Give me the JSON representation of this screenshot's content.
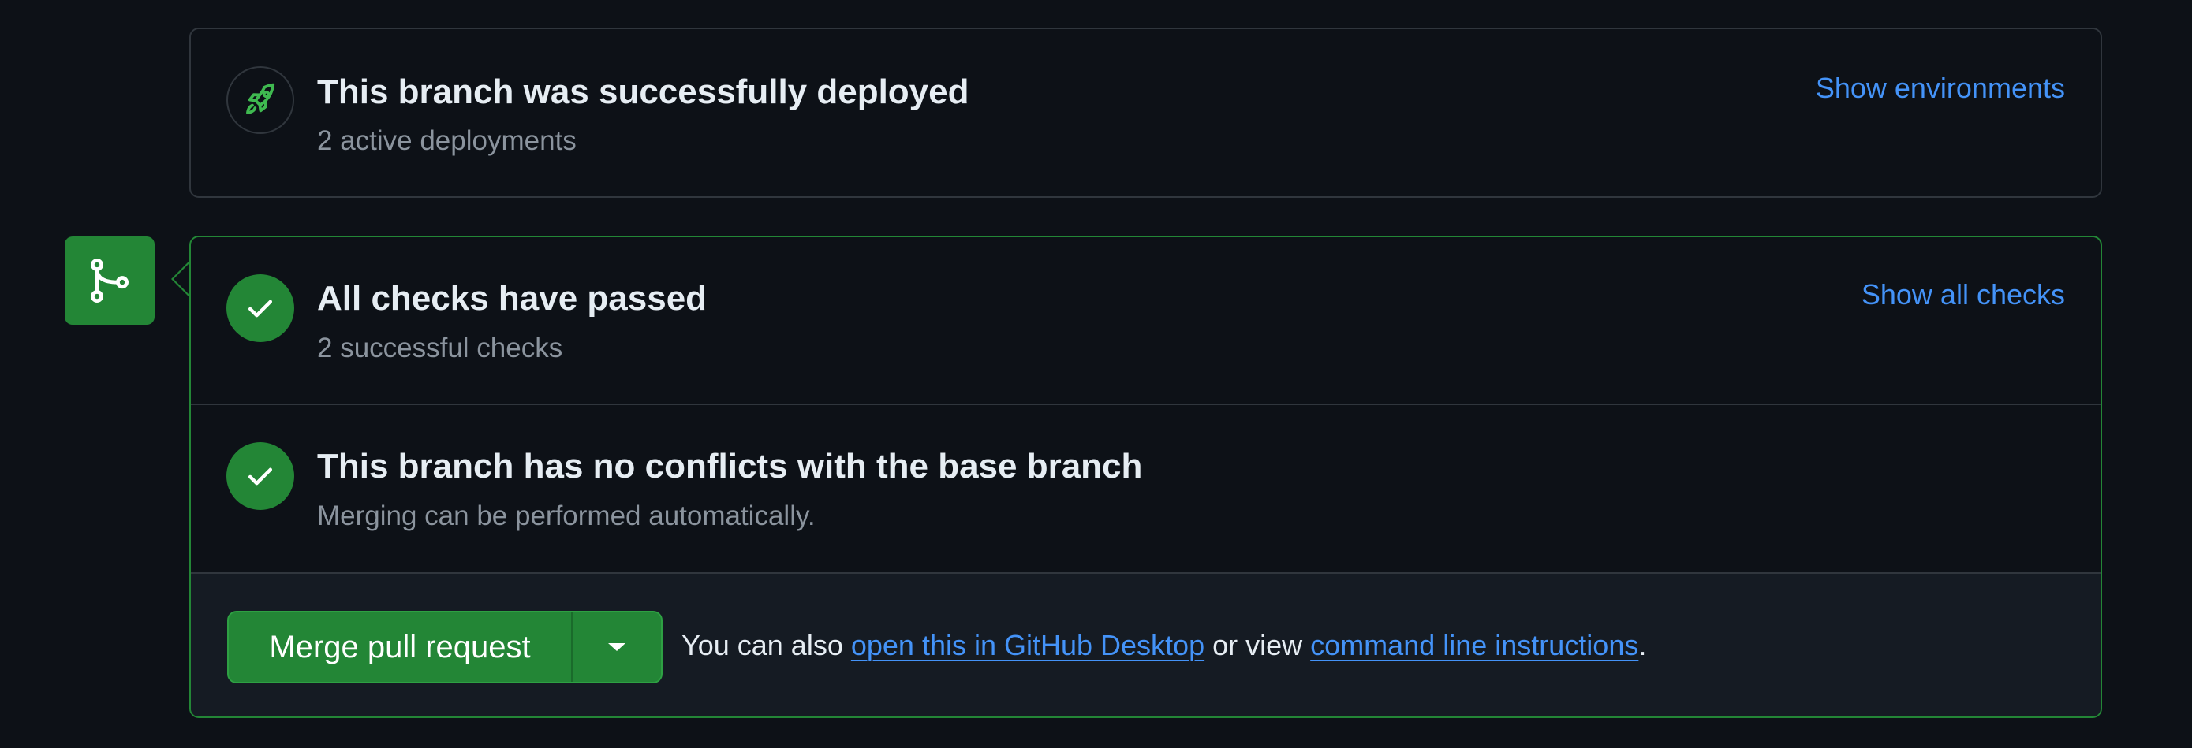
{
  "deployment": {
    "title": "This branch was successfully deployed",
    "subtitle": "2 active deployments",
    "link": "Show environments",
    "icon": "rocket-icon"
  },
  "checks": {
    "title": "All checks have passed",
    "subtitle": "2 successful checks",
    "link": "Show all checks",
    "icon": "check-icon"
  },
  "conflicts": {
    "title": "This branch has no conflicts with the base branch",
    "subtitle": "Merging can be performed automatically.",
    "icon": "check-icon"
  },
  "merge": {
    "button_label": "Merge pull request",
    "dropdown_icon": "caret-down-icon",
    "hint_prefix": "You can also",
    "desktop_link": "open this in GitHub Desktop",
    "hint_middle": "or view",
    "cli_link": "command line instructions",
    "hint_suffix": "."
  },
  "badge": {
    "icon": "git-merge-icon"
  },
  "colors": {
    "background": "#0d1117",
    "border": "#30363d",
    "success": "#238636",
    "link": "#4493f8",
    "muted": "#8b949e"
  }
}
